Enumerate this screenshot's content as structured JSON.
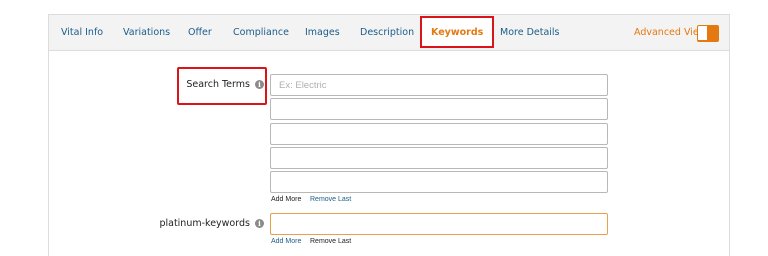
{
  "tabs": [
    {
      "label": "Vital Info"
    },
    {
      "label": "Variations"
    },
    {
      "label": "Offer"
    },
    {
      "label": "Compliance"
    },
    {
      "label": "Images"
    },
    {
      "label": "Description"
    },
    {
      "label": "Keywords",
      "active": true
    },
    {
      "label": "More Details"
    }
  ],
  "advanced_view": {
    "label": "Advanced View",
    "enabled": true
  },
  "search_terms": {
    "label": "Search Terms",
    "info_icon": "info-icon",
    "fields": [
      {
        "value": "",
        "placeholder": "Ex: Electric"
      },
      {
        "value": "",
        "placeholder": ""
      },
      {
        "value": "",
        "placeholder": ""
      },
      {
        "value": "",
        "placeholder": ""
      },
      {
        "value": "",
        "placeholder": ""
      }
    ],
    "add_more": "Add More",
    "remove_last": "Remove Last"
  },
  "platinum_keywords": {
    "label": "platinum-keywords",
    "info_icon": "info-icon",
    "value": "",
    "add_more": "Add More",
    "remove_last": "Remove Last"
  },
  "colors": {
    "accent": "#e47911",
    "link": "#1b5d8a",
    "highlight": "#d9141b"
  }
}
